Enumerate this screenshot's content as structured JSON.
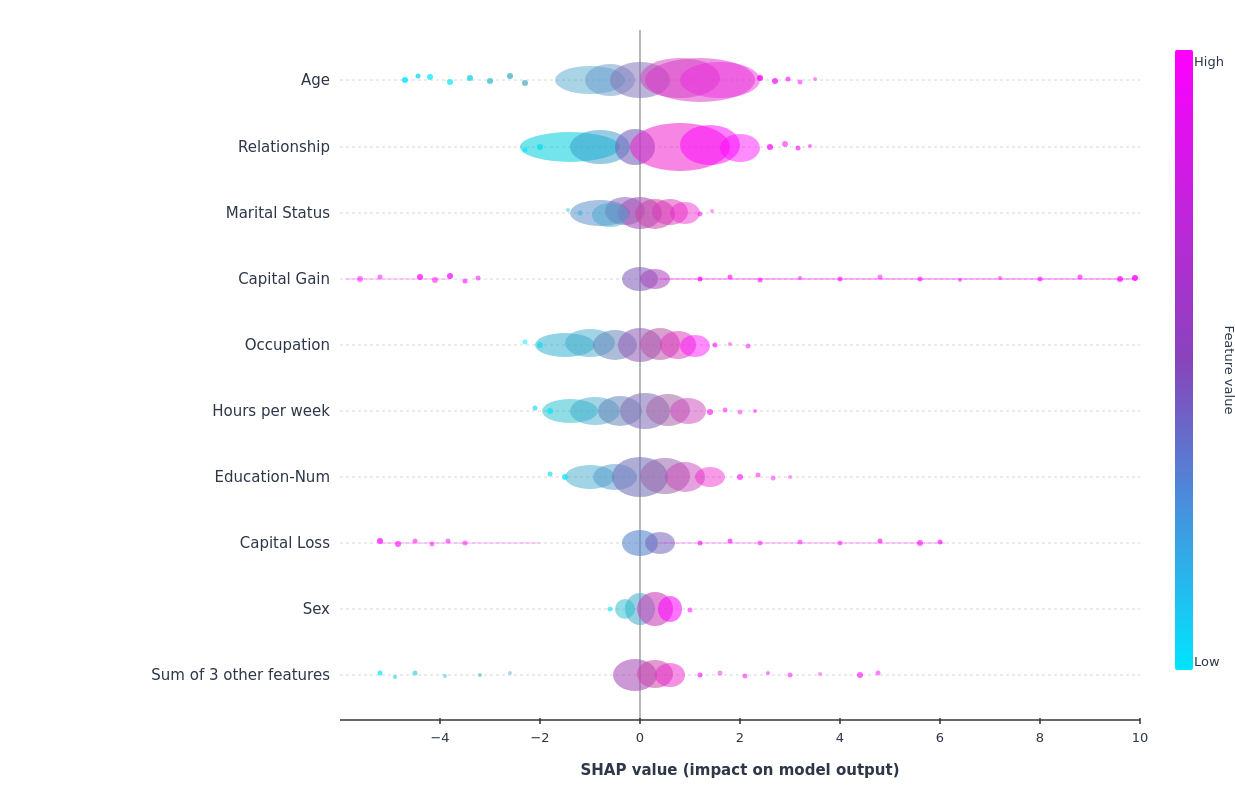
{
  "chart": {
    "title": "SHAP value (impact on model output)",
    "features": [
      {
        "name": "Age",
        "y": 80
      },
      {
        "name": "Relationship",
        "y": 147
      },
      {
        "name": "Marital Status",
        "y": 213
      },
      {
        "name": "Capital Gain",
        "y": 279
      },
      {
        "name": "Occupation",
        "y": 345
      },
      {
        "name": "Hours per week",
        "y": 411
      },
      {
        "name": "Education-Num",
        "y": 477
      },
      {
        "name": "Capital Loss",
        "y": 543
      },
      {
        "name": "Sex",
        "y": 609
      },
      {
        "name": "Sum of 3 other features",
        "y": 675
      }
    ],
    "x_ticks": [
      -4,
      -2,
      0,
      2,
      4,
      6,
      8,
      10
    ],
    "colorbar": {
      "high_label": "High",
      "low_label": "Low",
      "middle_label": "Feature value"
    },
    "colors": {
      "high": "#ff00ff",
      "mid": "#a066cc",
      "low": "#00bcd4"
    }
  }
}
